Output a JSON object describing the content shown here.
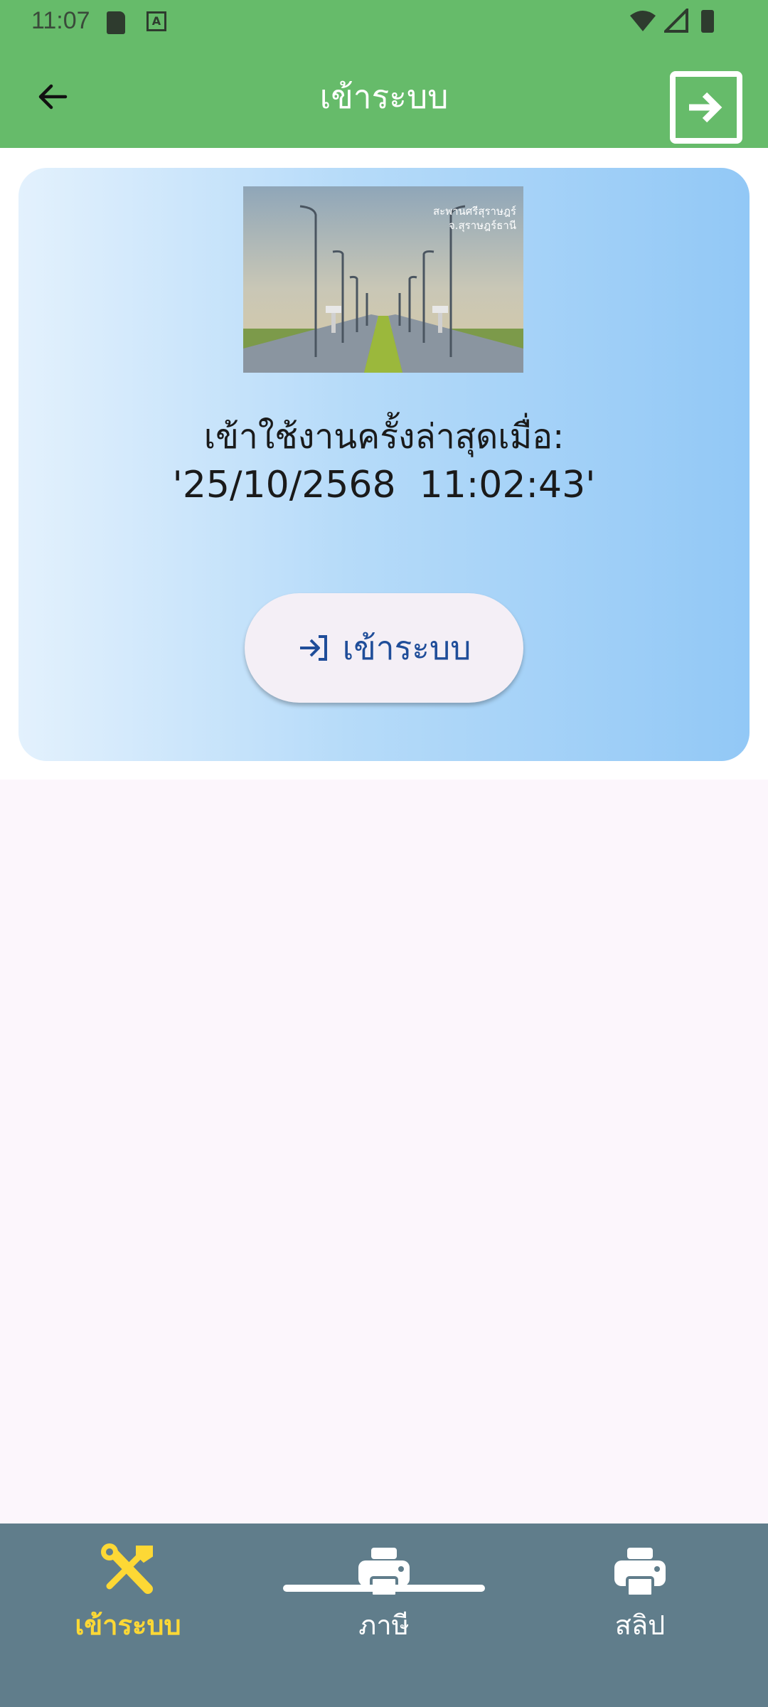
{
  "status_bar": {
    "time": "11:07",
    "notification_icons": [
      "sd-card-icon",
      "a-badge-icon"
    ],
    "system_icons": [
      "wifi-icon",
      "signal-icon",
      "battery-icon"
    ]
  },
  "app_bar": {
    "title": "เข้าระบบ",
    "back_icon": "arrow-left-icon",
    "action_icon": "login-box-icon"
  },
  "card": {
    "banner_caption_line1": "สะพานศรีสุราษฎร์",
    "banner_caption_line2": "จ.สุราษฎร์ธานี",
    "last_login_label": "เข้าใช้งานครั้งล่าสุดเมื่อ:",
    "last_login_value": "'25/10/2568  11:02:43'",
    "login_button_label": "เข้าระบบ",
    "login_button_icon": "login-arrow-icon",
    "gradient_start": "#e3f1fd",
    "gradient_end": "#92c8f6"
  },
  "bottom_nav": {
    "items": [
      {
        "label": "เข้าระบบ",
        "icon": "tools-icon",
        "active": true
      },
      {
        "label": "ภาษี",
        "icon": "printer-icon",
        "active": false
      },
      {
        "label": "สลิป",
        "icon": "printer-icon",
        "active": false
      }
    ],
    "background": "#607d8b",
    "active_color": "#fdd835"
  },
  "colors": {
    "primary": "#66bb6a",
    "accent_text": "#1f4d99"
  }
}
